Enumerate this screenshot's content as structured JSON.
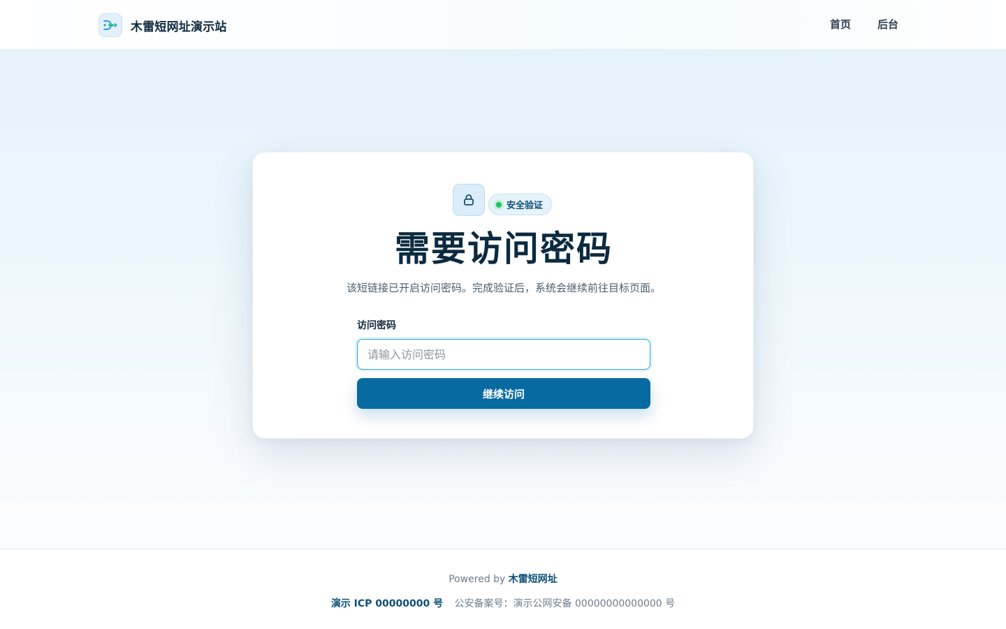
{
  "header": {
    "brand_name": "木雷短网址演示站",
    "logo_icon": "link-arrow-logo-icon",
    "nav": [
      {
        "label": "首页"
      },
      {
        "label": "后台"
      }
    ]
  },
  "card": {
    "lock_icon": "lock-icon",
    "badge_label": "安全验证",
    "title": "需要访问密码",
    "description": "该短链接已开启访问密码。完成验证后，系统会继续前往目标页面。",
    "field_label": "访问密码",
    "input_placeholder": "请输入访问密码",
    "input_value": "",
    "submit_label": "继续访问"
  },
  "footer": {
    "powered_prefix": "Powered by",
    "powered_brand": "木雷短网址",
    "icp": "演示 ICP 00000000 号",
    "police_record": "公安备案号：演示公网安备 00000000000000 号"
  },
  "colors": {
    "primary": "#076aa1",
    "accent_focus": "#27a3dc",
    "status_green": "#22c55e",
    "title_text": "#0c2a40"
  }
}
